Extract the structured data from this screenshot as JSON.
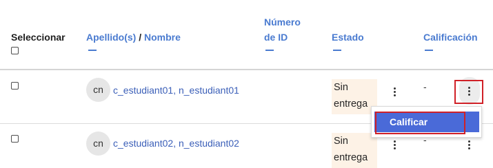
{
  "header": {
    "select_label": "Seleccionar",
    "surname_link": "Apellido(s)",
    "separator": "/",
    "name_link": "Nombre",
    "id_line1": "Número",
    "id_line2": "de ID",
    "status_label": "Estado",
    "grade_label": "Calificación"
  },
  "rows": [
    {
      "initials": "cn",
      "surname": "c_estudiant01",
      "name": "n_estudiant01",
      "status_line1": "Sin",
      "status_line2": "entrega",
      "grade": "-"
    },
    {
      "initials": "cn",
      "surname": "c_estudiant02",
      "name": "n_estudiant02",
      "status_line1": "Sin",
      "status_line2": "entrega",
      "grade": "-"
    }
  ],
  "menu": {
    "item_label": "Calificar"
  },
  "colors": {
    "link": "#4a7bd0",
    "highlight": "#d02027",
    "menu_active": "#4a6ad8",
    "status_bg": "#fdf2e6"
  }
}
